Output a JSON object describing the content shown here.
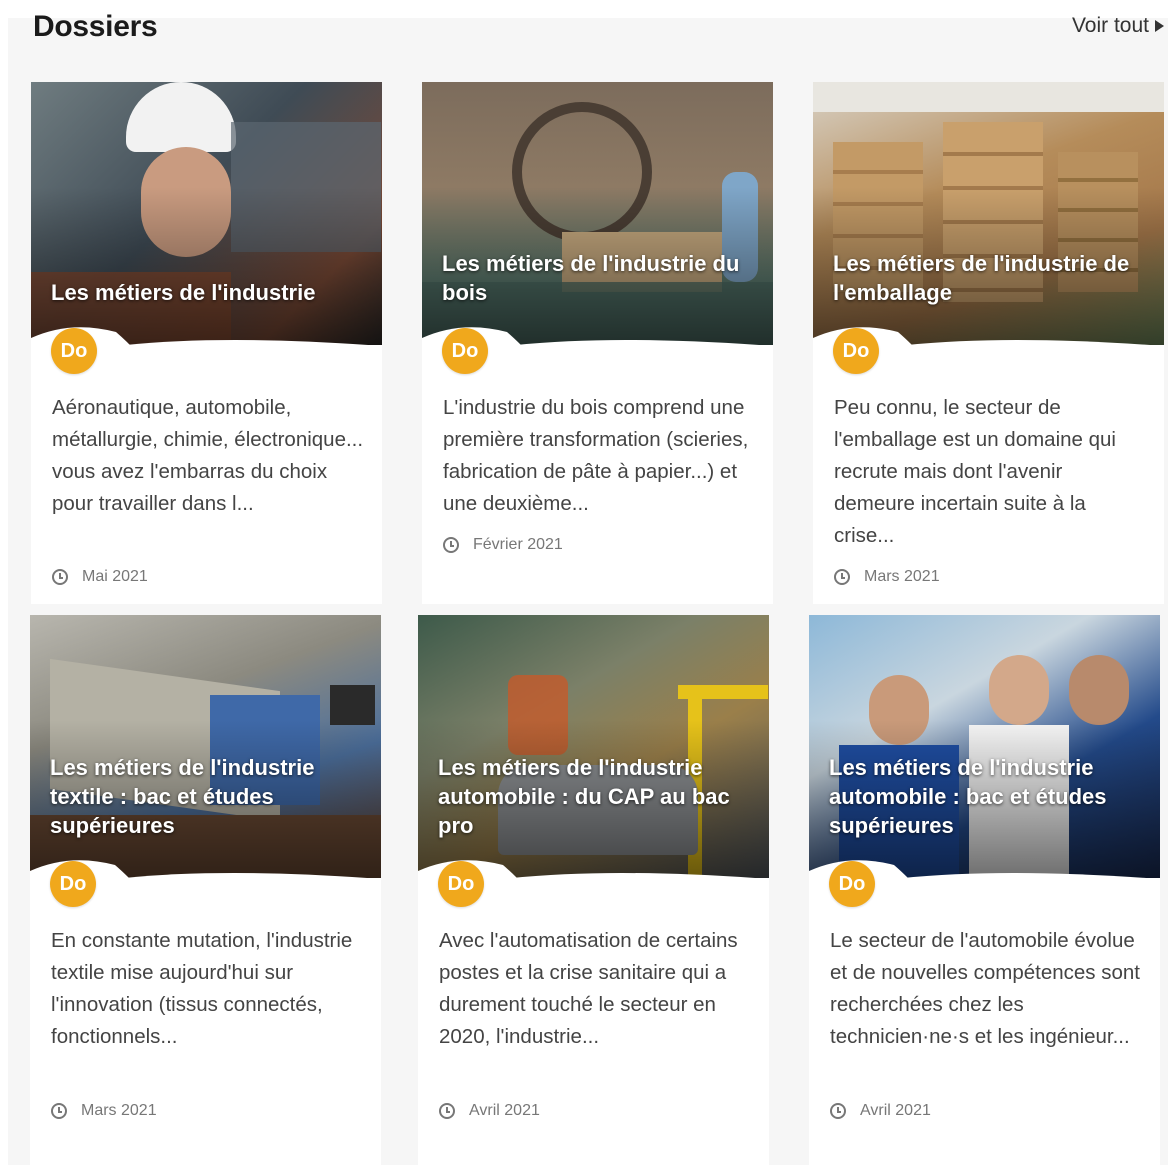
{
  "section": {
    "title": "Dossiers",
    "see_all": "Voir tout"
  },
  "colors": {
    "badge": "#f0a81c",
    "section_bg": "#f6f6f6"
  },
  "cards": [
    {
      "title": "Les métiers de l'industrie",
      "badge": "Do",
      "description": "Aéronautique, automobile, métallurgie, chimie, électronique... vous avez l'embarras du choix pour travailler dans l...",
      "date": "Mai 2021"
    },
    {
      "title": "Les métiers de l'industrie du bois",
      "badge": "Do",
      "description": "L'industrie du bois comprend une première transformation (scieries, fabrication de pâte à papier...) et une deuxième...",
      "date": "Février 2021"
    },
    {
      "title": "Les métiers de l'industrie de l'emballage",
      "badge": "Do",
      "description": "Peu connu, le secteur de l'emballage est un domaine qui recrute mais dont l'avenir demeure incertain suite à la crise...",
      "date": "Mars 2021"
    },
    {
      "title": "Les métiers de l'industrie textile : bac et études supérieures",
      "badge": "Do",
      "description": "En constante mutation, l'industrie textile mise aujourd'hui sur l'innovation (tissus connectés, fonctionnels...",
      "date": "Mars 2021"
    },
    {
      "title": "Les métiers de l'industrie automobile : du CAP au bac pro",
      "badge": "Do",
      "description": "Avec l'automatisation de certains postes et la crise sanitaire qui a durement touché le secteur en 2020, l'industrie...",
      "date": "Avril 2021"
    },
    {
      "title": "Les métiers de l'industrie automobile : bac et études supérieures",
      "badge": "Do",
      "description": "Le secteur de l'automobile évolue et de nouvelles compétences sont recherchées chez les technicien·ne·s et les ingénieur...",
      "date": "Avril 2021"
    }
  ]
}
